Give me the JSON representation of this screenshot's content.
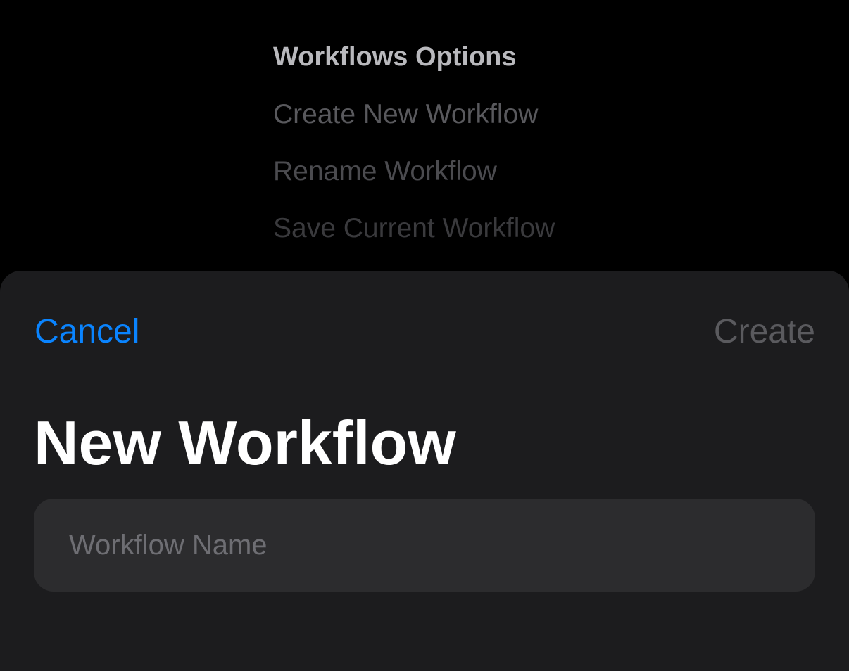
{
  "menu": {
    "title": "Workflows Options",
    "items": [
      {
        "label": "Create New Workflow"
      },
      {
        "label": "Rename Workflow"
      },
      {
        "label": "Save Current Workflow"
      }
    ]
  },
  "sheet": {
    "cancel_label": "Cancel",
    "create_label": "Create",
    "title": "New Workflow",
    "name_field": {
      "value": "",
      "placeholder": "Workflow Name"
    }
  },
  "colors": {
    "accent": "#0a84ff",
    "sheet_background": "#1c1c1e",
    "field_background": "#2c2c2e",
    "disabled_text": "#5a5a5e"
  }
}
